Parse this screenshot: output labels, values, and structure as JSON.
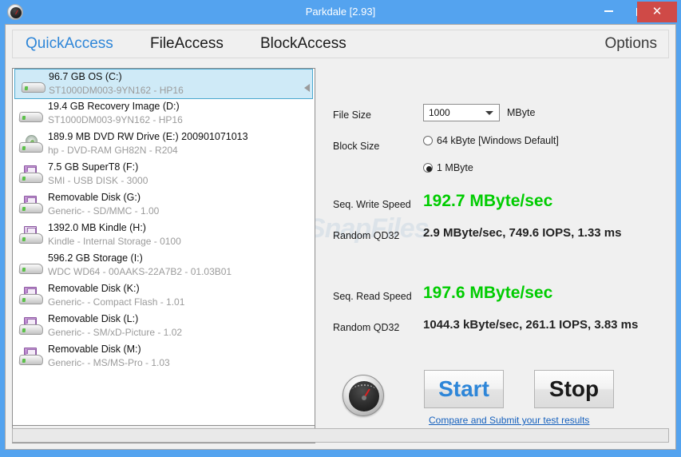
{
  "window": {
    "title": "Parkdale [2.93]",
    "app_icon": "speedometer-icon",
    "minimize_label": "–",
    "maximize_label": "□",
    "close_label": "✕",
    "titlebar_color": "#54a3ef",
    "close_button_color": "#cf4a47"
  },
  "tabs": [
    {
      "label": "QuickAccess",
      "active": true
    },
    {
      "label": "FileAccess",
      "active": false
    },
    {
      "label": "BlockAccess",
      "active": false
    },
    {
      "label": "Options",
      "active": false
    }
  ],
  "drives": [
    {
      "name": "96.7 GB OS (C:)",
      "info": "ST1000DM003-9YN162 - HP16",
      "icon": "hdd-icon",
      "selected": true
    },
    {
      "name": "19.4 GB Recovery Image (D:)",
      "info": "ST1000DM003-9YN162 - HP16",
      "icon": "hdd-icon",
      "selected": false
    },
    {
      "name": "189.9 MB DVD RW Drive (E:) 200901071013",
      "info": "hp - DVD-RAM GH82N - R204",
      "icon": "optical-icon",
      "selected": false
    },
    {
      "name": "7.5 GB SuperT8 (F:)",
      "info": "SMI - USB DISK - 3000",
      "icon": "removable-icon",
      "selected": false
    },
    {
      "name": "Removable Disk (G:)",
      "info": "Generic- - SD/MMC - 1.00",
      "icon": "removable-icon",
      "selected": false
    },
    {
      "name": "1392.0 MB Kindle (H:)",
      "info": "Kindle - Internal Storage - 0100",
      "icon": "removable-icon",
      "selected": false
    },
    {
      "name": "596.2 GB Storage (I:)",
      "info": "WDC WD64 - 00AAKS-22A7B2 - 01.03B01",
      "icon": "hdd-icon",
      "selected": false
    },
    {
      "name": "Removable Disk (K:)",
      "info": "Generic- - Compact Flash - 1.01",
      "icon": "removable-icon",
      "selected": false
    },
    {
      "name": "Removable Disk (L:)",
      "info": "Generic- - SM/xD-Picture - 1.02",
      "icon": "removable-icon",
      "selected": false
    },
    {
      "name": "Removable Disk (M:)",
      "info": "Generic- - MS/MS-Pro - 1.03",
      "icon": "removable-icon",
      "selected": false
    }
  ],
  "list_scrollbar": {
    "left_arrow": "‹",
    "right_arrow": "›"
  },
  "settings": {
    "file_size_label": "File Size",
    "file_size_value": "1000",
    "file_size_unit": "MByte",
    "block_size_label": "Block Size",
    "block_options": [
      {
        "label": "64 kByte [Windows Default]",
        "selected": false
      },
      {
        "label": "1 MByte",
        "selected": true
      }
    ]
  },
  "results": {
    "write_label": "Seq. Write Speed",
    "write_value": "192.7 MByte/sec",
    "write_random_label": "Random QD32",
    "write_random_value": "2.9 MByte/sec, 749.6 IOPS, 1.33 ms",
    "read_label": "Seq. Read Speed",
    "read_value": "197.6 MByte/sec",
    "read_random_label": "Random QD32",
    "read_random_value": "1044.3 kByte/sec, 261.1 IOPS, 3.83 ms",
    "speed_color": "#00cc00"
  },
  "actions": {
    "gauge_icon": "speedometer-icon",
    "start_label": "Start",
    "stop_label": "Stop",
    "compare_link": "Compare and Submit your test results",
    "start_color": "#2e86d8",
    "link_color": "#1560bd"
  },
  "watermark": {
    "mark": "Ⓒ",
    "text": "SnapFiles"
  }
}
